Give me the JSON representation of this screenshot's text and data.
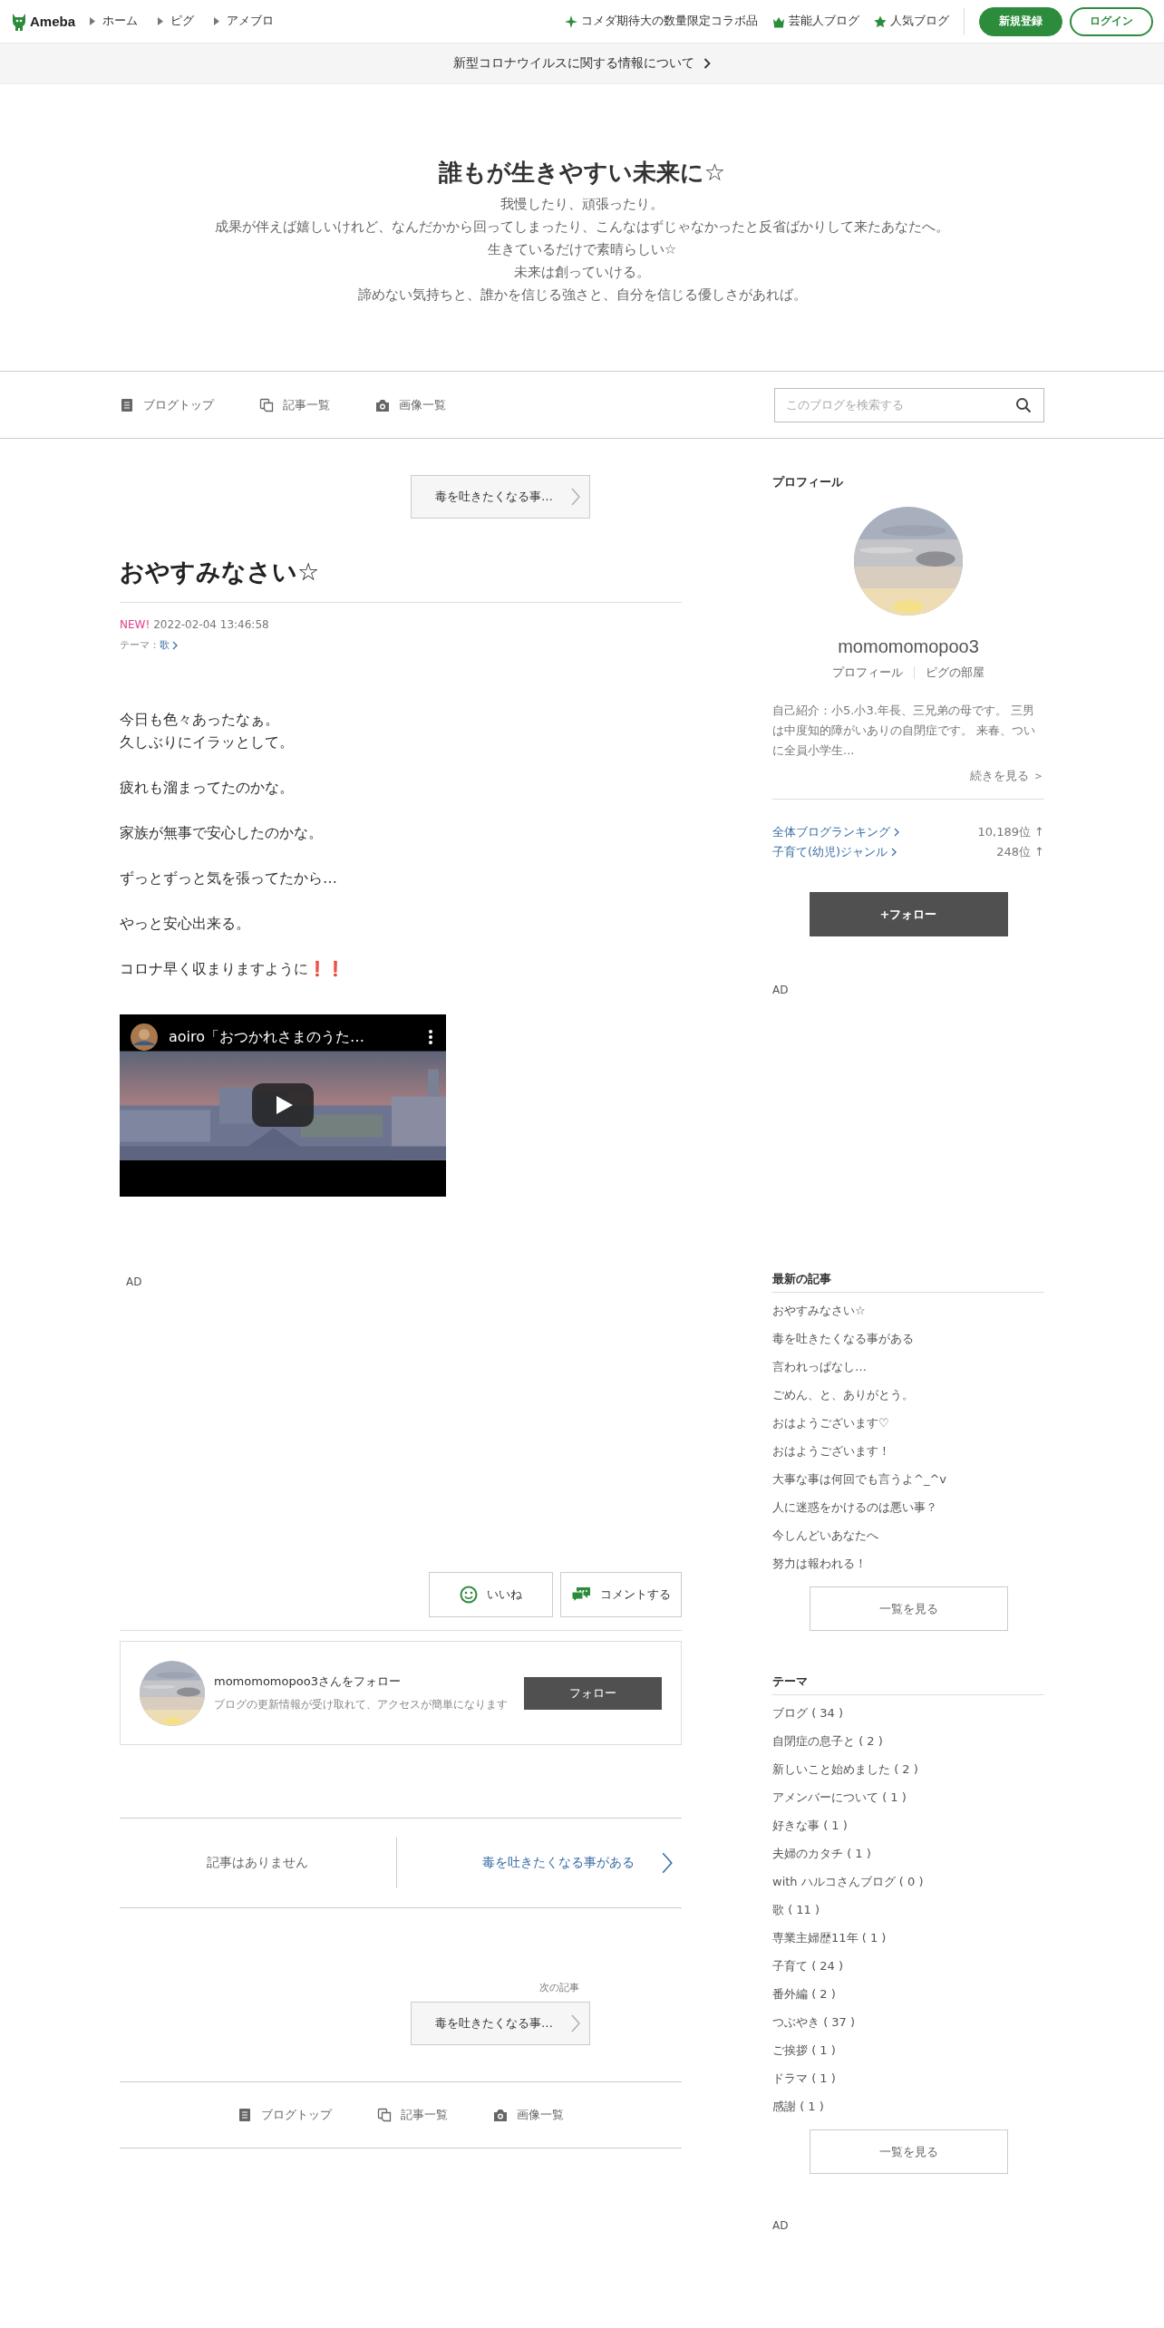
{
  "header": {
    "logo": "Ameba",
    "nav_links": [
      "ホーム",
      "ピグ",
      "アメブロ"
    ],
    "promo_links": [
      "コメダ期待大の数量限定コラボ品",
      "芸能人ブログ",
      "人気ブログ"
    ],
    "register_button": "新規登録",
    "login_button": "ログイン"
  },
  "notice_bar": {
    "text": "新型コロナウイルスに関する情報について"
  },
  "blog": {
    "title": "誰もが生きやすい未来に☆",
    "description": [
      "我慢したり、頑張ったり。",
      "成果が伴えば嬉しいけれど、なんだかから回ってしまったり、こんなはずじゃなかったと反省ばかりして来たあなたへ。",
      "生きているだけで素晴らしい☆",
      "未来は創っていける。",
      "諦めない気持ちと、誰かを信じる強さと、自分を信じる優しさがあれば。"
    ]
  },
  "blog_nav": {
    "items": [
      "ブログトップ",
      "記事一覧",
      "画像一覧"
    ],
    "search": {
      "placeholder": "このブログを検索する"
    }
  },
  "article": {
    "prev_button": "毒を吐きたくなる事…",
    "title": "おやすみなさい☆",
    "new_badge": "NEW!",
    "date": "2022-02-04 13:46:58",
    "theme_label": "テーマ：",
    "theme": "歌",
    "paragraphs": [
      [
        "今日も色々あったなぁ。",
        "久しぶりにイラッとして。"
      ],
      [
        "疲れも溜まってたのかな。"
      ],
      [
        "家族が無事で安心したのかな。"
      ],
      [
        "ずっとずっと気を張ってたから…"
      ],
      [
        "やっと安心出来る。"
      ],
      [
        "コロナ早く収まりますように❗❗"
      ]
    ],
    "video": {
      "title": "aoiro「おつかれさまのうた…"
    },
    "ad_label": "AD",
    "like_button": "いいね",
    "comment_button": "コメントする",
    "follow_card": {
      "title": "momomomopoo3さんをフォロー",
      "subtitle": "ブログの更新情報が受け取れて、アクセスが簡単になります",
      "button": "フォロー"
    },
    "pager": {
      "prev": "記事はありません",
      "next": "毒を吐きたくなる事がある"
    },
    "next_label": "次の記事",
    "next_button": "毒を吐きたくなる事…"
  },
  "bottom_nav": {
    "items": [
      "ブログトップ",
      "記事一覧",
      "画像一覧"
    ]
  },
  "sidebar": {
    "profile": {
      "heading": "プロフィール",
      "name": "momomomopoo3",
      "links": [
        "プロフィール",
        "ピグの部屋"
      ],
      "intro": "自己紹介：小5.小3.年長、三兄弟の母です。 三男は中度知的障がいありの自閉症です。 来春、ついに全員小学生...",
      "more": "続きを見る ＞",
      "rankings": [
        {
          "label": "全体ブログランキング",
          "value": "10,189位 ↑"
        },
        {
          "label": "子育て(幼児)ジャンル",
          "value": "248位 ↑"
        }
      ],
      "follow_button": "+フォロー"
    },
    "ad_label": "AD",
    "latest": {
      "heading": "最新の記事",
      "items": [
        "おやすみなさい☆",
        "毒を吐きたくなる事がある",
        "言われっぱなし…",
        "ごめん、と、ありがとう。",
        "おはようございます♡",
        "おはようございます！",
        "大事な事は何回でも言うよ^_^v",
        "人に迷惑をかけるのは悪い事？",
        "今しんどいあなたへ",
        "努力は報われる！"
      ],
      "more_button": "一覧を見る"
    },
    "themes": {
      "heading": "テーマ",
      "items": [
        "ブログ ( 34 )",
        "自閉症の息子と ( 2 )",
        "新しいこと始めました ( 2 )",
        "アメンバーについて ( 1 )",
        "好きな事 ( 1 )",
        "夫婦のカタチ ( 1 )",
        "with ハルコさんブログ ( 0 )",
        "歌 ( 11 )",
        "専業主婦歴11年 ( 1 )",
        "子育て ( 24 )",
        "番外編 ( 2 )",
        "つぶやき ( 37 )",
        "ご挨拶 ( 1 )",
        "ドラマ ( 1 )",
        "感謝 ( 1 )"
      ],
      "more_button": "一覧を見る"
    },
    "bottom_ad_label": "AD"
  }
}
